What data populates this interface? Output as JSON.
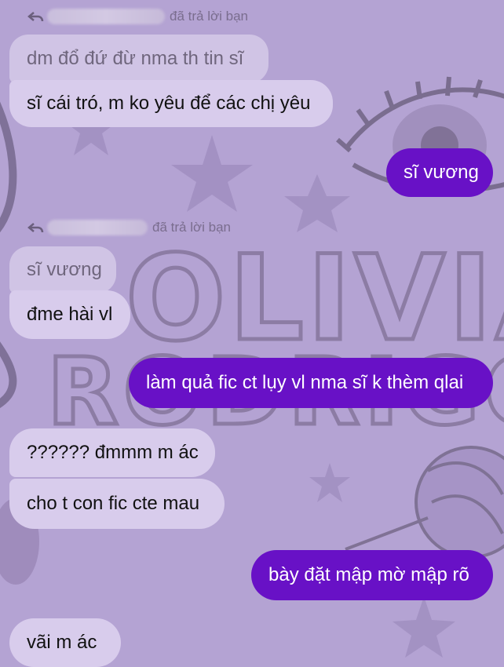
{
  "replies": [
    {
      "header": "đã trả lời bạn",
      "quoted": "dm đổ đứ đừ nma th tin sĩ"
    },
    {
      "header": "đã trả lời bạn",
      "quoted": "sĩ vương"
    }
  ],
  "messages": [
    {
      "text": "sĩ cái tró, m ko yêu để các chị yêu"
    },
    {
      "text": "sĩ vương"
    },
    {
      "text": "đme hài vl"
    },
    {
      "text": "làm quả fic ct lụy vl nma sĩ k thèm qlai"
    },
    {
      "text": "?????? đmmm m ác"
    },
    {
      "text": "cho t con fic cte mau"
    },
    {
      "text": "bày đặt mập mờ mập rõ"
    },
    {
      "text": "vãi m ác"
    }
  ],
  "background": {
    "art_text_top": "OLIVIA",
    "art_text_bottom": "RODRIGO"
  },
  "colors": {
    "background": "#b4a3d3",
    "incoming_bubble": "#d8ccec",
    "outgoing_bubble": "#6811c6",
    "header_text": "#7a6d8e"
  }
}
